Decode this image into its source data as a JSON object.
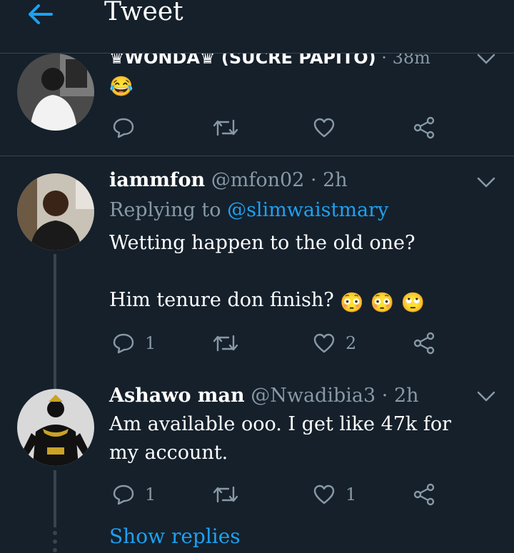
{
  "header": {
    "title": "Tweet"
  },
  "tweets": [
    {
      "name": "♛WONDA♛ (SUCRE PAPITO)",
      "time": "38m",
      "text": "😂",
      "actions": {
        "reply": "",
        "retweet": "",
        "like": ""
      }
    },
    {
      "name": "iammfon",
      "handle": "@mfon02",
      "time": "2h",
      "replying_prefix": "Replying to",
      "replying_user": "@slimwaistmary",
      "text_line1": "Wetting happen to the old one?",
      "text_line2": "Him tenure don finish?",
      "emojis": [
        "😳",
        "😳",
        "🙄"
      ],
      "actions": {
        "reply": "1",
        "retweet": "",
        "like": "2"
      }
    },
    {
      "name": "Ashawo man",
      "handle": "@Nwadibia3",
      "time": "2h",
      "text_line1": "Am available ooo. I get like 47k for",
      "text_line2": "my account.",
      "actions": {
        "reply": "1",
        "retweet": "",
        "like": "1"
      }
    }
  ],
  "show_replies": "Show replies",
  "colors": {
    "background": "#15202b",
    "accent": "#1da1f2",
    "muted": "#8899a6",
    "divider": "#38444d"
  }
}
